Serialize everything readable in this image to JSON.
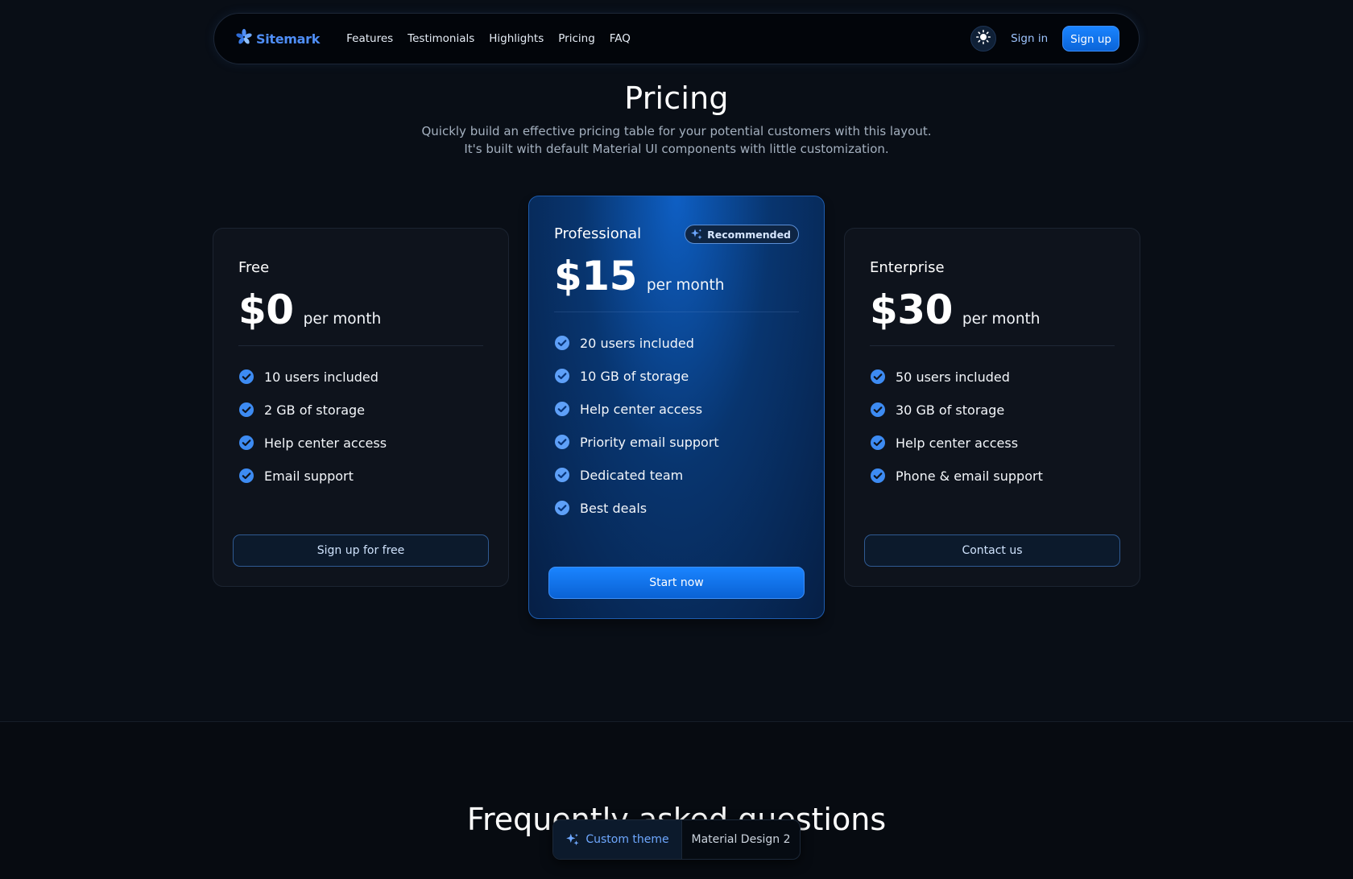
{
  "nav": {
    "brand": "Sitemark",
    "links": [
      "Features",
      "Testimonials",
      "Highlights",
      "Pricing",
      "FAQ"
    ],
    "sign_in": "Sign in",
    "sign_up": "Sign up"
  },
  "header": {
    "title": "Pricing",
    "subtitle_line1": "Quickly build an effective pricing table for your potential customers with this layout.",
    "subtitle_line2": "It's built with default Material UI components with little customization."
  },
  "plans": [
    {
      "name": "Free",
      "price": "$0",
      "period": "per month",
      "features": [
        "10 users included",
        "2 GB of storage",
        "Help center access",
        "Email support"
      ],
      "cta": "Sign up for free"
    },
    {
      "name": "Professional",
      "badge": "Recommended",
      "price": "$15",
      "period": "per month",
      "features": [
        "20 users included",
        "10 GB of storage",
        "Help center access",
        "Priority email support",
        "Dedicated team",
        "Best deals"
      ],
      "cta": "Start now"
    },
    {
      "name": "Enterprise",
      "price": "$30",
      "period": "per month",
      "features": [
        "50 users included",
        "30 GB of storage",
        "Help center access",
        "Phone & email support"
      ],
      "cta": "Contact us"
    }
  ],
  "faq": {
    "title": "Frequently asked questions"
  },
  "theme_toggle": {
    "active": "Custom theme",
    "inactive": "Material Design 2"
  },
  "colors": {
    "accent": "#1a84ff",
    "brand": "#4f8ef7",
    "background": "#090e16",
    "check": "#3d8bf2"
  },
  "icons": {
    "brand": "sitemark-logo-icon",
    "theme": "sun-icon",
    "check": "check-circle-icon",
    "sparkle": "sparkle-icon"
  }
}
